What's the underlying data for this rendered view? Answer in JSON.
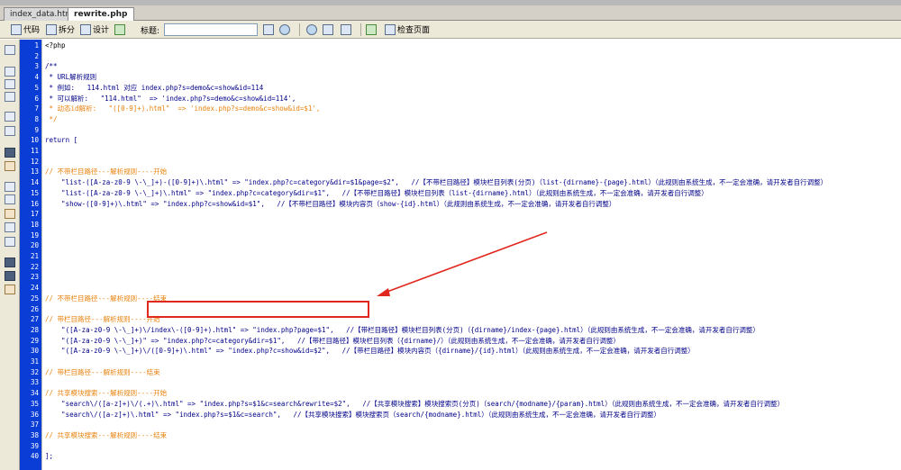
{
  "tabs": [
    {
      "label": "index_data.html"
    },
    {
      "label": "rewrite.php"
    }
  ],
  "toolbar": {
    "code_label": "代码",
    "split_label": "拆分",
    "design_label": "设计",
    "title_label": "标题:",
    "title_value": "",
    "check_label": "检查页面"
  },
  "lines": [
    {
      "n": "1",
      "text": "<?php",
      "cls": ""
    },
    {
      "n": "2",
      "text": "",
      "cls": ""
    },
    {
      "n": "3",
      "text": "/**",
      "cls": "c-str"
    },
    {
      "n": "4",
      "text": " * URL解析规则",
      "cls": "c-str"
    },
    {
      "n": "5",
      "text": " * 例如:   114.html 对应 index.php?s=demo&c=show&id=114",
      "cls": "c-str"
    },
    {
      "n": "6",
      "text": " * 可以解析:   \"114.html\"  => 'index.php?s=demo&c=show&id=114',",
      "cls": "c-str"
    },
    {
      "n": "7",
      "text": " * 动态id解析:   \"([0-9]+).html\"  => 'index.php?s=demo&c=show&id=$1',",
      "cls": "c-cmt"
    },
    {
      "n": "8",
      "text": " */",
      "cls": "c-cmt"
    },
    {
      "n": "9",
      "text": "",
      "cls": ""
    },
    {
      "n": "10",
      "text": "return [",
      "cls": "c-str"
    },
    {
      "n": "11",
      "text": "",
      "cls": ""
    },
    {
      "n": "12",
      "text": "",
      "cls": ""
    },
    {
      "n": "13",
      "text": "// 不带栏目路径---解析规则----开始",
      "cls": "c-cmt"
    },
    {
      "n": "14",
      "text": "    \"list-([A-za-z0-9 \\-\\_]+)-([0-9]+)\\.html\" => \"index.php?c=category&dir=$1&page=$2\",   //【不带栏目路径】模块栏目列表(分页)（list-{dirname}-{page}.html）（此规则由系统生成，不一定会准确，请开发者自行调整）",
      "cls": "c-str"
    },
    {
      "n": "15",
      "text": "    \"list-([A-za-z0-9 \\-\\_]+)\\.html\" => \"index.php?c=category&dir=$1\",   //【不带栏目路径】模块栏目列表（list-{dirname}.html）（此规则由系统生成，不一定会准确，请开发者自行调整）",
      "cls": "c-str"
    },
    {
      "n": "16",
      "text": "    \"show-([0-9]+)\\.html\" => \"index.php?c=show&id=$1\",   //【不带栏目路径】模块内容页（show-{id}.html）（此规则由系统生成，不一定会准确，请开发者自行调整）",
      "cls": "c-str"
    },
    {
      "n": "17",
      "text": "",
      "cls": ""
    },
    {
      "n": "18",
      "text": "",
      "cls": ""
    },
    {
      "n": "19",
      "text": "",
      "cls": ""
    },
    {
      "n": "20",
      "text": "",
      "cls": ""
    },
    {
      "n": "21",
      "text": "",
      "cls": ""
    },
    {
      "n": "22",
      "text": "",
      "cls": ""
    },
    {
      "n": "23",
      "text": "",
      "cls": ""
    },
    {
      "n": "24",
      "text": "",
      "cls": ""
    },
    {
      "n": "25",
      "text": "// 不带栏目路径---解析规则----结束",
      "cls": "c-cmt"
    },
    {
      "n": "26",
      "text": "",
      "cls": ""
    },
    {
      "n": "27",
      "text": "// 带栏目路径---解析规则----开始",
      "cls": "c-cmt"
    },
    {
      "n": "28",
      "text": "    \"([A-za-z0-9 \\-\\_]+)\\/index\\-([0-9]+).html\" => \"index.php?page=$1\",   //【带栏目路径】模块栏目列表(分页)（{dirname}/index-{page}.html）（此规则由系统生成，不一定会准确，请开发者自行调整）",
      "cls": "c-str"
    },
    {
      "n": "29",
      "text": "    \"([A-za-z0-9 \\-\\_]+)\" => \"index.php?c=category&dir=$1\",   //【带栏目路径】模块栏目列表（{dirname}/）（此规则由系统生成，不一定会准确，请开发者自行调整）",
      "cls": "c-str"
    },
    {
      "n": "30",
      "text": "    \"([A-za-z0-9 \\-\\_]+)\\/([0-9]+)\\.html\" => \"index.php?c=show&id=$2\",   //【带栏目路径】模块内容页（{dirname}/{id}.html）（此规则由系统生成，不一定会准确，请开发者自行调整）",
      "cls": "c-str"
    },
    {
      "n": "31",
      "text": "",
      "cls": ""
    },
    {
      "n": "32",
      "text": "// 带栏目路径---解析规则----结束",
      "cls": "c-cmt"
    },
    {
      "n": "33",
      "text": "",
      "cls": ""
    },
    {
      "n": "34",
      "text": "// 共享模块搜索---解析规则----开始",
      "cls": "c-cmt"
    },
    {
      "n": "35",
      "text": "    \"search\\/([a-z]+)\\/(.+)\\.html\" => \"index.php?s=$1&c=search&rewrite=$2\",   //【共享模块搜索】模块搜索页(分页)（search/{modname}/{param}.html）（此规则由系统生成，不一定会准确，请开发者自行调整）",
      "cls": "c-str"
    },
    {
      "n": "36",
      "text": "    \"search\\/([a-z]+)\\.html\" => \"index.php?s=$1&c=search\",   //【共享模块搜索】模块搜索页（search/{modname}.html）（此规则由系统生成，不一定会准确，请开发者自行调整）",
      "cls": "c-str"
    },
    {
      "n": "37",
      "text": "",
      "cls": ""
    },
    {
      "n": "38",
      "text": "// 共享模块搜索---解析规则----结束",
      "cls": "c-cmt"
    },
    {
      "n": "39",
      "text": "",
      "cls": ""
    },
    {
      "n": "40",
      "text": "];",
      "cls": "c-str"
    }
  ]
}
